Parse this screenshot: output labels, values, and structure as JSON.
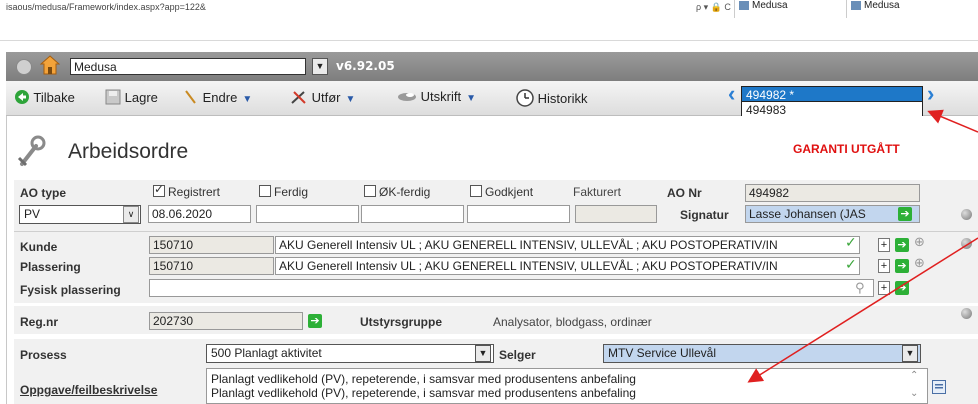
{
  "browser": {
    "url": "isaous/medusa/Framework/index.aspx?app=122&",
    "controls": "ρ ▾ 🔒 C",
    "tabs": [
      "Medusa",
      "Medusa"
    ]
  },
  "app": {
    "selected_app": "Medusa",
    "version": "v6.92.05"
  },
  "toolbar": {
    "back": "Tilbake",
    "save": "Lagre",
    "edit": "Endre",
    "execute": "Utfør",
    "print": "Utskrift",
    "history": "Historikk"
  },
  "record_nav": {
    "options": [
      "494982 *",
      "494983"
    ],
    "selected_index": 0
  },
  "page": {
    "title": "Arbeidsordre",
    "warranty_status": "GARANTI UTGÅTT"
  },
  "form": {
    "ao_type_label": "AO type",
    "ao_type_value": "PV",
    "statuses": [
      {
        "label": "Registrert",
        "checked": true,
        "date": "08.06.2020"
      },
      {
        "label": "Ferdig",
        "checked": false,
        "date": ""
      },
      {
        "label": "ØK-ferdig",
        "checked": false,
        "date": ""
      },
      {
        "label": "Godkjent",
        "checked": false,
        "date": ""
      },
      {
        "label": "Fakturert",
        "checked": false,
        "date": ""
      }
    ],
    "ao_nr_label": "AO Nr",
    "ao_nr_value": "494982",
    "signatur_label": "Signatur",
    "signatur_value": "Lasse Johansen (JAS",
    "kunde_label": "Kunde",
    "kunde_code": "150710",
    "kunde_name": "AKU Generell Intensiv UL ; AKU GENERELL INTENSIV, ULLEVÅL ; AKU POSTOPERATIV/IN",
    "plassering_label": "Plassering",
    "plassering_code": "150710",
    "plassering_name": "AKU Generell Intensiv UL ; AKU GENERELL INTENSIV, ULLEVÅL ; AKU POSTOPERATIV/IN",
    "fysisk_label": "Fysisk plassering",
    "fysisk_value": "",
    "regnr_label": "Reg.nr",
    "regnr_value": "202730",
    "utstyrsgruppe_label": "Utstyrsgruppe",
    "utstyrsgruppe_value": "Analysator, blodgass, ordinær",
    "prosess_label": "Prosess",
    "prosess_value": "500 Planlagt aktivitet",
    "selger_label": "Selger",
    "selger_value": "MTV Service Ullevål",
    "oppgave_label": "Oppgave/feilbeskrivelse",
    "oppgave_lines": [
      "Planlagt vedlikehold (PV), repeterende, i samsvar med produsentens anbefaling",
      "Planlagt vedlikehold (PV), repeterende, i samsvar med produsentens anbefaling"
    ]
  },
  "colors": {
    "warning": "#e01010",
    "annotation_arrow": "#e02020",
    "selected_id_bg": "#1e78c8",
    "nav_arrow": "#2a7fd4"
  }
}
